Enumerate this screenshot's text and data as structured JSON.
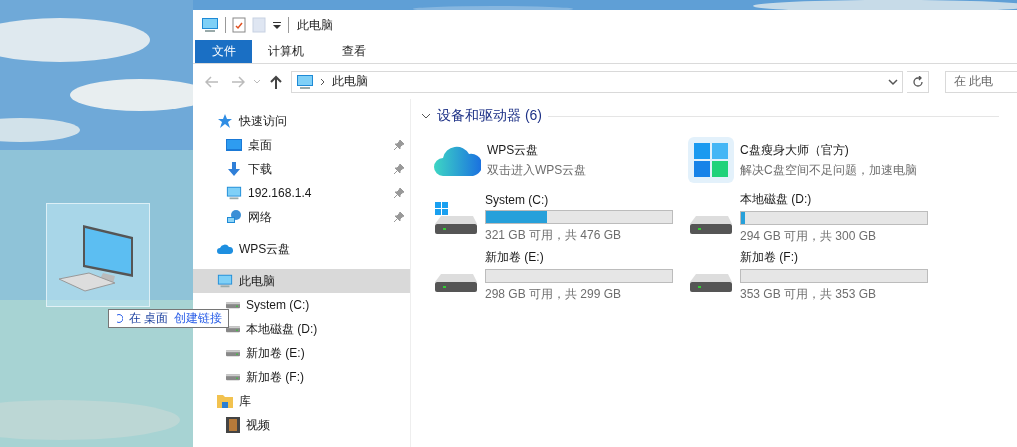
{
  "window": {
    "title": "此电脑"
  },
  "ribbon_tabs": [
    {
      "label": "文件",
      "selected": true
    },
    {
      "label": "计算机",
      "selected": false
    },
    {
      "label": "查看",
      "selected": false
    }
  ],
  "address": {
    "path": "此电脑",
    "search_placeholder": "在 此电"
  },
  "nav": [
    {
      "kind": "star",
      "label": "快速访问",
      "selected": false,
      "children": [
        {
          "kind": "desktop",
          "label": "桌面",
          "selected": false,
          "pinned": true
        },
        {
          "kind": "download",
          "label": "下载",
          "selected": false,
          "pinned": true
        },
        {
          "kind": "monitor",
          "label": "192.168.1.4",
          "selected": false,
          "pinned": true
        },
        {
          "kind": "network",
          "label": "网络",
          "selected": false,
          "pinned": true
        }
      ]
    },
    {
      "kind": "cloud",
      "label": "WPS云盘",
      "selected": false
    },
    {
      "kind": "monitor",
      "label": "此电脑",
      "selected": true,
      "children": [
        {
          "kind": "drive",
          "label": "System (C:)",
          "selected": false
        },
        {
          "kind": "drive",
          "label": "本地磁盘 (D:)",
          "selected": false
        },
        {
          "kind": "drive",
          "label": "新加卷 (E:)",
          "selected": false
        },
        {
          "kind": "drive",
          "label": "新加卷 (F:)",
          "selected": false
        }
      ]
    },
    {
      "kind": "library",
      "label": "库",
      "selected": false,
      "children": [
        {
          "kind": "video",
          "label": "视频",
          "selected": false
        }
      ]
    }
  ],
  "section": {
    "title": "设备和驱动器 (6)",
    "items": [
      {
        "kind": "cloud-app",
        "name": "WPS云盘",
        "subtitle": "双击进入WPS云盘"
      },
      {
        "kind": "tiles-app",
        "name": "C盘瘦身大师（官方)",
        "subtitle": "解决C盘空间不足问题，加速电脑"
      },
      {
        "kind": "drive",
        "name": "System (C:)",
        "system": true,
        "level": 0.33,
        "reading": "321 GB 可用，共 476 GB"
      },
      {
        "kind": "drive",
        "name": "本地磁盘 (D:)",
        "system": false,
        "level": 0.02,
        "reading": "294 GB 可用，共 300 GB"
      },
      {
        "kind": "drive",
        "name": "新加卷 (E:)",
        "system": false,
        "level": 0.0,
        "reading": "298 GB 可用，共 299 GB"
      },
      {
        "kind": "drive",
        "name": "新加卷 (F:)",
        "system": false,
        "level": 0.0,
        "reading": "353 GB 可用，共 353 GB"
      }
    ]
  },
  "drag_tooltip": {
    "prefix": "在 桌面",
    "action": "创建链接"
  }
}
